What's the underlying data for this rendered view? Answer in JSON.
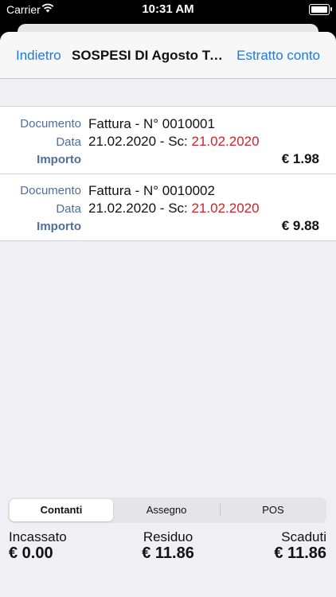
{
  "status_bar": {
    "carrier": "Carrier",
    "time": "10:31 AM"
  },
  "nav": {
    "back": "Indietro",
    "title": "SOSPESI DI Agosto Te...",
    "right": "Estratto conto"
  },
  "documents": [
    {
      "doc_label": "Documento",
      "doc_value": "Fattura - N° 0010001",
      "date_label": "Data",
      "date_value": "21.02.2020 - Sc: ",
      "due_value": "21.02.2020",
      "amount_label": "Importo",
      "amount_value": "€ 1.98"
    },
    {
      "doc_label": "Documento",
      "doc_value": "Fattura - N° 0010002",
      "date_label": "Data",
      "date_value": "21.02.2020 - Sc: ",
      "due_value": "21.02.2020",
      "amount_label": "Importo",
      "amount_value": "€ 9.88"
    }
  ],
  "payment_tabs": [
    "Contanti",
    "Assegno",
    "POS"
  ],
  "selected_tab": "Contanti",
  "totals": {
    "collected_label": "Incassato",
    "collected_value": "€ 0.00",
    "residual_label": "Residuo",
    "residual_value": "€ 11.86",
    "overdue_label": "Scaduti",
    "overdue_value": "€ 11.86"
  },
  "colors": {
    "accent": "#1f7ad9",
    "overdue": "#c9252b",
    "label": "#4f6f9a"
  },
  "icons": [
    "wifi-icon",
    "battery-icon"
  ]
}
